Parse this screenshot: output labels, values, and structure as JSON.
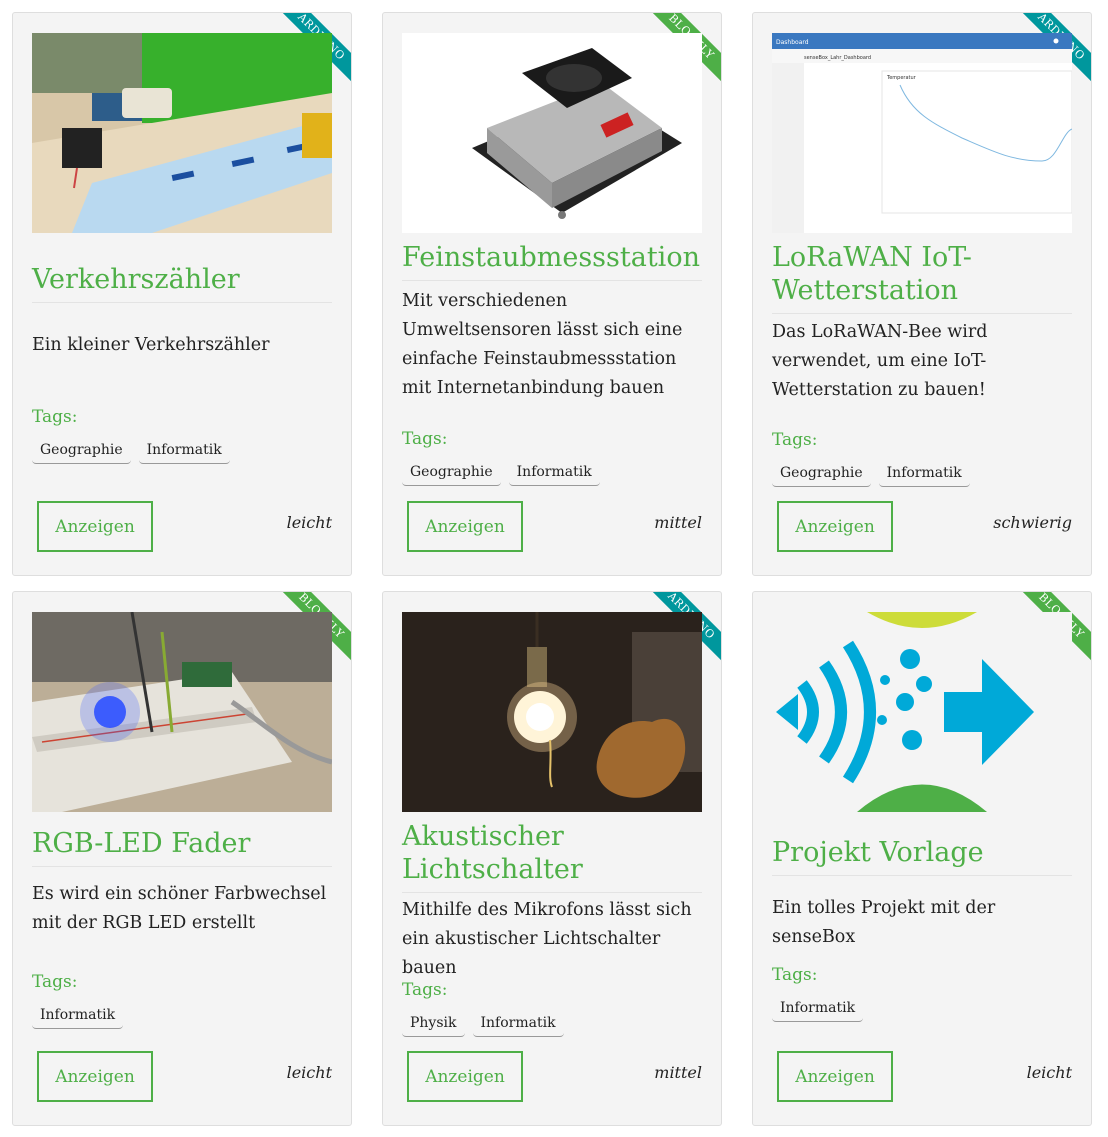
{
  "cards": [
    {
      "ribbon": "ARDUINO",
      "title": "Verkehrszähler",
      "description": "Ein kleiner Verkehrszähler",
      "tags_label": "Tags:",
      "tags": [
        "Geographie",
        "Informatik"
      ],
      "button": "Anzeigen",
      "level": "leicht"
    },
    {
      "ribbon": "BLOCKLY",
      "title": "Feinstaubmessstation",
      "description": "Mit verschiedenen Umweltsensoren lässt sich eine einfache Feinstaubmessstation mit Internetanbindung bauen",
      "tags_label": "Tags:",
      "tags": [
        "Geographie",
        "Informatik"
      ],
      "button": "Anzeigen",
      "level": "mittel"
    },
    {
      "ribbon": "ARDUINO",
      "title": "LoRaWAN IoT-Wetterstation",
      "description": "Das LoRaWAN-Bee wird verwendet, um eine IoT-Wetterstation zu bauen!",
      "tags_label": "Tags:",
      "tags": [
        "Geographie",
        "Informatik"
      ],
      "button": "Anzeigen",
      "level": "schwierig"
    },
    {
      "ribbon": "BLOCKLY",
      "title": "RGB-LED Fader",
      "description": "Es wird ein schöner Farbwechsel mit der RGB LED erstellt",
      "tags_label": "Tags:",
      "tags": [
        "Informatik"
      ],
      "button": "Anzeigen",
      "level": "leicht"
    },
    {
      "ribbon": "ARDUINO",
      "title": "Akustischer Lichtschalter",
      "description": "Mithilfe des Mikrofons lässt sich ein akustischer Lichtschalter bauen",
      "tags_label": "Tags:",
      "tags": [
        "Physik",
        "Informatik"
      ],
      "button": "Anzeigen",
      "level": "mittel"
    },
    {
      "ribbon": "BLOCKLY",
      "title": "Projekt Vorlage",
      "description": "Ein tolles Projekt mit der senseBox",
      "tags_label": "Tags:",
      "tags": [
        "Informatik"
      ],
      "button": "Anzeigen",
      "level": "leicht"
    }
  ],
  "dashboard_image": {
    "app_label": "Dashboard",
    "dashboard_title": "senseBox_Lahr_Dashboard",
    "chart_title": "Temperatur"
  },
  "colors": {
    "accent": "#4eaf47",
    "ribbon_arduino": "#00979d",
    "ribbon_blockly": "#4eaf47",
    "card_bg": "#f4f4f4"
  }
}
